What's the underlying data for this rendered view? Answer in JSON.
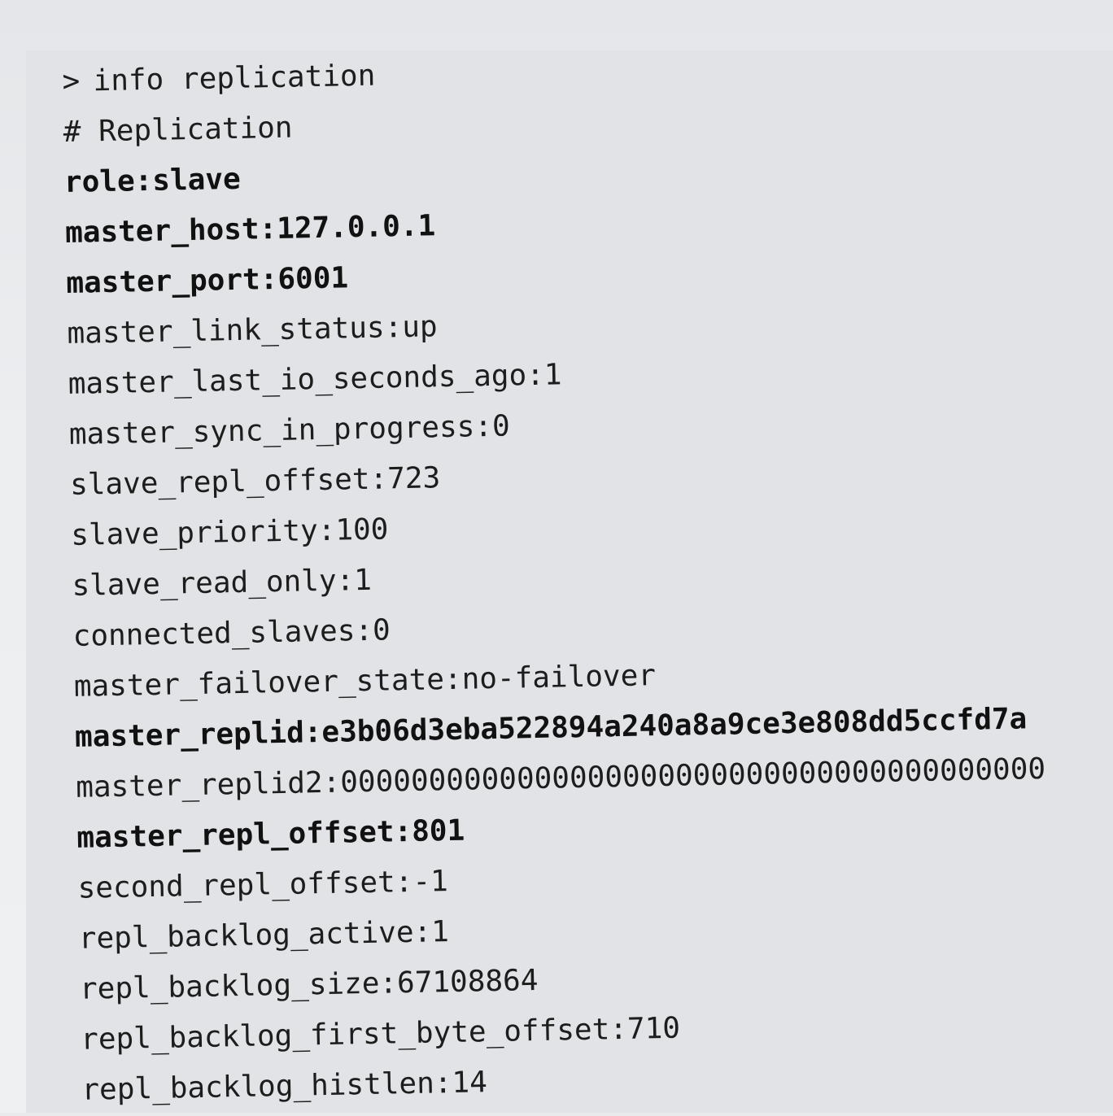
{
  "command": {
    "prompt": ">",
    "text": "info replication"
  },
  "section_header": "# Replication",
  "lines": [
    {
      "text": "role:slave",
      "bold": true
    },
    {
      "text": "master_host:127.0.0.1",
      "bold": true
    },
    {
      "text": "master_port:6001",
      "bold": true
    },
    {
      "text": "master_link_status:up",
      "bold": false
    },
    {
      "text": "master_last_io_seconds_ago:1",
      "bold": false
    },
    {
      "text": "master_sync_in_progress:0",
      "bold": false
    },
    {
      "text": "slave_repl_offset:723",
      "bold": false
    },
    {
      "text": "slave_priority:100",
      "bold": false
    },
    {
      "text": "slave_read_only:1",
      "bold": false
    },
    {
      "text": "connected_slaves:0",
      "bold": false
    },
    {
      "text": "master_failover_state:no-failover",
      "bold": false
    },
    {
      "text": "master_replid:e3b06d3eba522894a240a8a9ce3e808dd5ccfd7a",
      "bold": true
    },
    {
      "text": "master_replid2:0000000000000000000000000000000000000000",
      "bold": false
    },
    {
      "text": "master_repl_offset:801",
      "bold": true
    },
    {
      "text": "second_repl_offset:-1",
      "bold": false
    },
    {
      "text": "repl_backlog_active:1",
      "bold": false
    },
    {
      "text": "repl_backlog_size:67108864",
      "bold": false
    },
    {
      "text": "repl_backlog_first_byte_offset:710",
      "bold": false
    },
    {
      "text": "repl_backlog_histlen:14",
      "bold": false
    }
  ]
}
